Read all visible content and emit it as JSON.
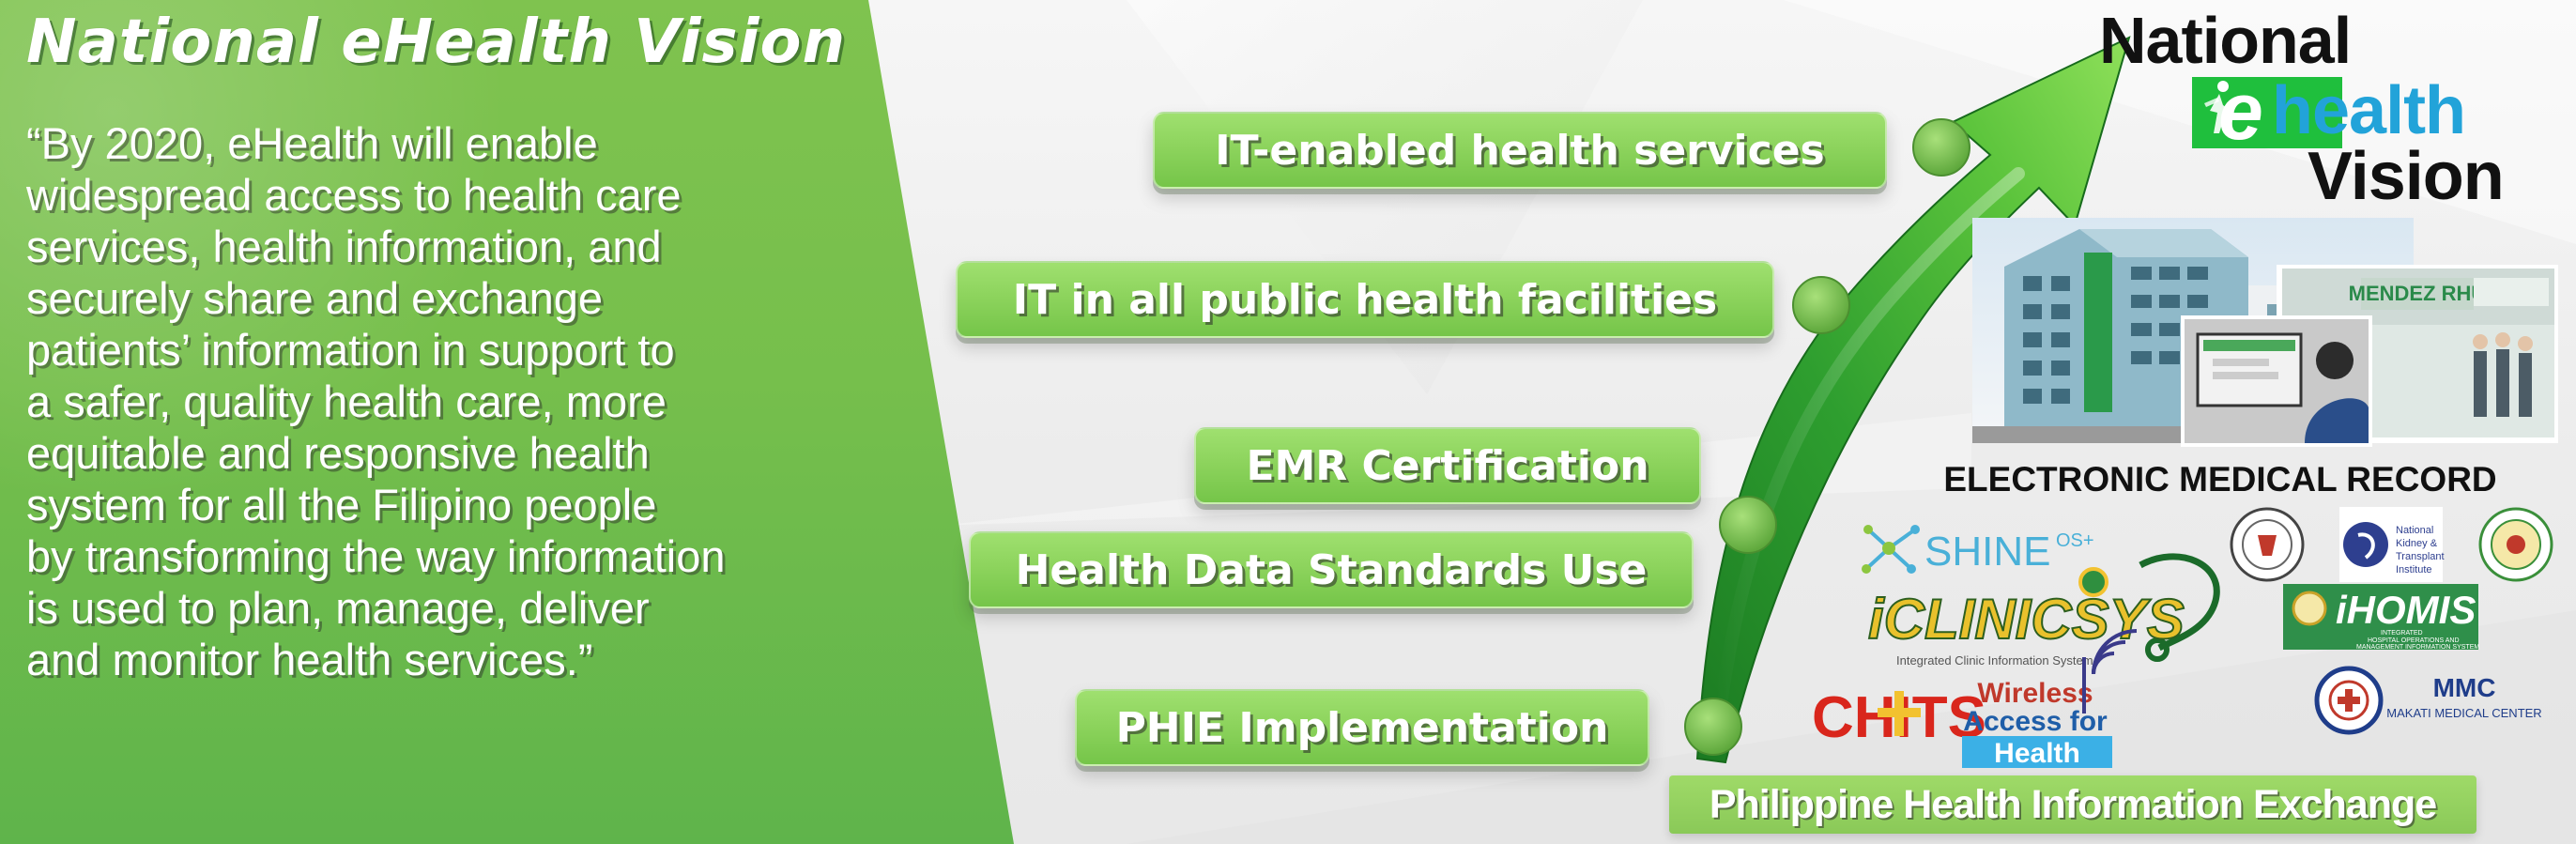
{
  "title": "National eHealth Vision",
  "quote_lines": [
    "“By 2020, eHealth will enable",
    "widespread access to health care",
    "services, health information, and",
    "securely share and exchange",
    "patients’ information in support to",
    "a safer, quality health care, more",
    "equitable and responsive health",
    "system for all the Filipino people",
    "by transforming the way information",
    "is used to plan, manage, deliver",
    "and monitor health services.”"
  ],
  "milestones": [
    {
      "label": "IT-enabled health services"
    },
    {
      "label": "IT in all public health facilities"
    },
    {
      "label": "EMR Certification"
    },
    {
      "label": "Health Data Standards Use"
    },
    {
      "label": "PHIE Implementation"
    }
  ],
  "logo": {
    "national": "National",
    "e": "e",
    "health": "health",
    "vision": "Vision"
  },
  "emr_caption": "ELECTRONIC MEDICAL RECORD",
  "partner_logos": {
    "shine": "SHINE",
    "shine_sup": "OS+",
    "iclinicsys": "iCLINICSYS",
    "iclinicsys_tagline": "Integrated Clinic Information System",
    "ihomis": "iHOMIS",
    "ihomis_sub1": "INTEGRATED",
    "ihomis_sub2": "HOSPITAL OPERATIONS AND",
    "ihomis_sub3": "MANAGEMENT INFORMATION SYSTEM",
    "chits": "CHITS",
    "wah_line1": "Wireless",
    "wah_line2": "Access for",
    "wah_line3": "Health",
    "nkti_line1": "National",
    "nkti_line2": "Kidney &",
    "nkti_line3": "Transplant",
    "nkti_line4": "Institute",
    "mmc": "MMC",
    "mmc_full": "MAKATI MEDICAL CENTER"
  },
  "photo_labels": {
    "building_sign": "MENDEZ RHU"
  },
  "phie_banner": "Philippine Health Information Exchange",
  "colors": {
    "panel_green": "#76bf4c",
    "button_green": "#8cd35c",
    "arrow_dark": "#1f8f2a",
    "arrow_light": "#7ed957",
    "ehealth_blue": "#22a3d9",
    "ehealth_green": "#1fbf3d",
    "chits_red": "#d9261c"
  },
  "icons": {
    "logo_figure": "running-figure-icon",
    "stethoscope": "stethoscope-icon",
    "wifi": "wireless-signal-icon",
    "caduceus": "caduceus-icon"
  }
}
